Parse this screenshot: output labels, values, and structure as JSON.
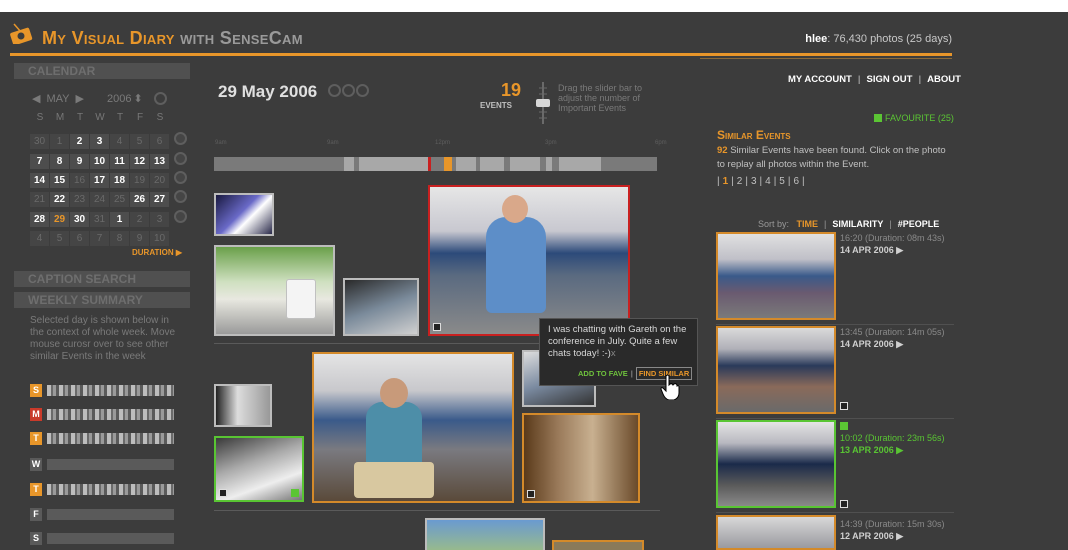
{
  "app": {
    "title_main": "My Visual Diary",
    "title_with": "with",
    "title_product": "SenseCam",
    "user_name": "hlee",
    "user_stats": ": 76,430 photos (25 days)"
  },
  "nav": {
    "my_account": "MY ACCOUNT",
    "sign_out": "SIGN OUT",
    "about": "ABOUT",
    "separator": "|"
  },
  "sidebar": {
    "calendar_heading": "CALENDAR",
    "month": "MAY",
    "year": "2006",
    "prev_arrow": "◀",
    "next_arrow": "▶",
    "year_spinner": "⬍",
    "weekdays": [
      "S",
      "M",
      "T",
      "W",
      "T",
      "F",
      "S"
    ],
    "weeks": [
      [
        "30",
        "1",
        "2",
        "3",
        "4",
        "5",
        "6"
      ],
      [
        "7",
        "8",
        "9",
        "10",
        "11",
        "12",
        "13"
      ],
      [
        "14",
        "15",
        "16",
        "17",
        "18",
        "19",
        "20"
      ],
      [
        "21",
        "22",
        "23",
        "24",
        "25",
        "26",
        "27"
      ],
      [
        "28",
        "29",
        "30",
        "31",
        "1",
        "2",
        "3"
      ],
      [
        "4",
        "5",
        "6",
        "7",
        "8",
        "9",
        "10"
      ]
    ],
    "duration_link": "DURATION ▶",
    "caption_search_heading": "CAPTION SEARCH",
    "weekly_summary_heading": "WEEKLY SUMMARY",
    "weekly_desc": "Selected day is shown below in the context of whole week. Move mouse curosr over to see other similar Events in the week",
    "week_days": [
      {
        "letter": "S",
        "color": "#e8962a"
      },
      {
        "letter": "M",
        "color": "#c93a2a"
      },
      {
        "letter": "T",
        "color": "#e8962a"
      },
      {
        "letter": "W",
        "color": "#5a5a5a"
      },
      {
        "letter": "T",
        "color": "#e8962a"
      },
      {
        "letter": "F",
        "color": "#5a5a5a"
      },
      {
        "letter": "S",
        "color": "#5a5a5a"
      }
    ]
  },
  "main": {
    "date": "29 May 2006",
    "events_count": "19",
    "events_label": "EVENTS",
    "slider_hint": "Drag the slider bar to adjust the number of Important Events",
    "time_labels": [
      "9am",
      "9am",
      "12pm",
      "3pm",
      "6pm"
    ]
  },
  "tooltip": {
    "text": "I was chatting with Gareth on the conference in July. Quite a few chats today!",
    "emoticon": ":-)",
    "close": "x",
    "add_to_fave": "ADD TO FAVE",
    "separator": "|",
    "find_similar": "FIND SIMILAR"
  },
  "similar": {
    "favourite": "FAVOURITE (25)",
    "title": "Similar Events",
    "count": "92",
    "description": " Similar Events have been found. Click on the photo to replay all photos within the Event.",
    "pages": [
      "1",
      "2",
      "3",
      "4",
      "5",
      "6"
    ],
    "sort_label": "Sort by:",
    "sort_time": "TIME",
    "sort_similarity": "SIMILARITY",
    "sort_people": "#PEOPLE",
    "events": [
      {
        "time": "16:20 (Duration: 08m 43s)",
        "date": "14 APR 2006 ▶"
      },
      {
        "time": "13:45 (Duration: 14m 05s)",
        "date": "14 APR 2006 ▶"
      },
      {
        "time": "10:02 (Duration: 23m 56s)",
        "date": "13 APR 2006 ▶"
      },
      {
        "time": "14:39 (Duration: 15m 30s)",
        "date": "12 APR 2006 ▶"
      }
    ]
  },
  "colors": {
    "accent": "#e8962a",
    "favourite_green": "#5bc534",
    "selected_red": "#c92020",
    "background": "#3c3c3c"
  }
}
